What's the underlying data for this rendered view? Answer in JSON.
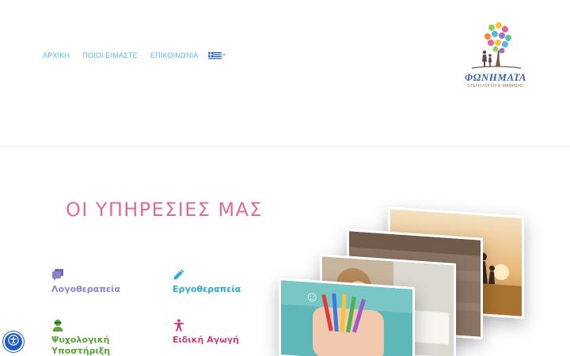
{
  "nav": {
    "items": [
      {
        "label": "ΑΡΧΙΚΗ"
      },
      {
        "label": "ΠΟΙΟΙ ΕΙΜΑΣΤΕ"
      },
      {
        "label": "ΕΠΙΚΟΙΝΩΝΙΑ"
      }
    ],
    "language_flag": "greece-flag-icon",
    "language_caret": "▾"
  },
  "logo": {
    "name": "ΦΩΝΗΜΑΤΑ",
    "subtitle": "ΣΤΕΓΗ ΛΟΓΟΥ & ΜΑΘΗΣΗΣ"
  },
  "services": {
    "title": "ΟΙ ΥΠΗΡΕΣΙΕΣ ΜΑΣ",
    "items": [
      {
        "label": "Λογοθεραπεία",
        "icon": "speech-bubbles-icon",
        "color": "#8b83c9"
      },
      {
        "label": "Εργοθεραπεία",
        "icon": "pencil-icon",
        "color": "#2ea8d8"
      },
      {
        "label": "Ψυχολογική Υποστήριξη",
        "icon": "person-icon",
        "color": "#5aa33a"
      },
      {
        "label": "Ειδική Αγωγή",
        "icon": "child-figure-icon",
        "color": "#d23f7c"
      }
    ]
  },
  "photos": [
    {
      "name": "photo-sunset-family"
    },
    {
      "name": "photo-hands-heart"
    },
    {
      "name": "photo-child-playing"
    },
    {
      "name": "photo-child-crayons"
    }
  ],
  "colors": {
    "nav": "#58b8e6",
    "title": "#e06a9e",
    "logo_text": "#3a5fb0",
    "accessibility": "#1f5bc6"
  },
  "accessibility": {
    "icon": "accessibility-icon"
  }
}
